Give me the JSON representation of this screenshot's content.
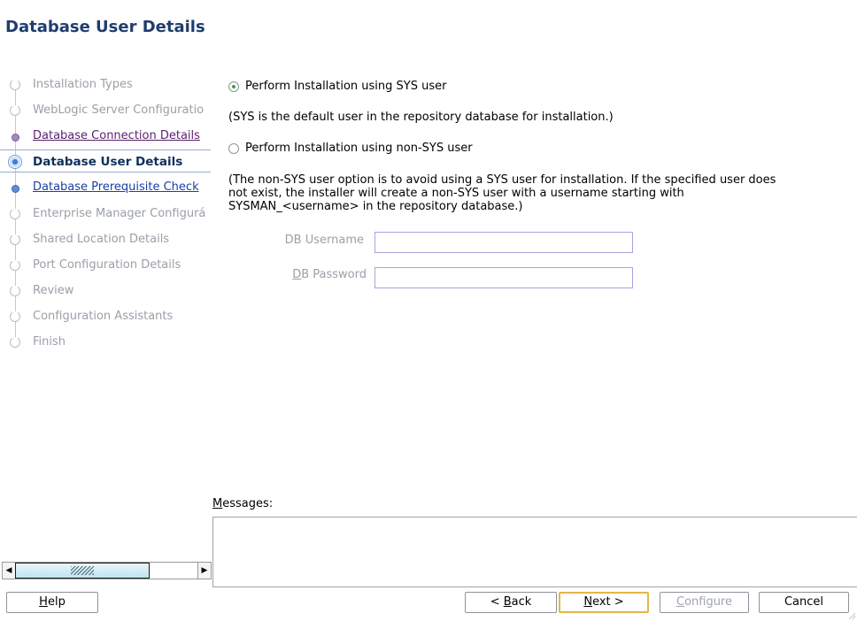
{
  "page": {
    "title": "Database User Details"
  },
  "steps": [
    {
      "label": "Installation Types",
      "state": "future"
    },
    {
      "label": "WebLogic Server Configuratio",
      "state": "future"
    },
    {
      "label": "Database Connection Details",
      "state": "done"
    },
    {
      "label": "Database User Details",
      "state": "current"
    },
    {
      "label": "Database Prerequisite Check",
      "state": "link"
    },
    {
      "label": "Enterprise Manager Configurá",
      "state": "future"
    },
    {
      "label": "Shared Location Details",
      "state": "future"
    },
    {
      "label": "Port Configuration Details",
      "state": "future"
    },
    {
      "label": "Review",
      "state": "future"
    },
    {
      "label": "Configuration Assistants",
      "state": "future"
    },
    {
      "label": "Finish",
      "state": "future"
    }
  ],
  "options": {
    "sys": {
      "label": "Perform Installation using SYS user",
      "selected": true,
      "description": "(SYS is the default user in the repository database for installation.)"
    },
    "nonsys": {
      "label": "Perform Installation using non-SYS user",
      "selected": false,
      "description_lines": [
        "(The non-SYS user option is to avoid using a SYS user for installation. If the specified user does",
        "not exist, the installer will create a non-SYS user with a username starting with",
        "SYSMAN_<username> in the repository database.)"
      ]
    }
  },
  "fields": {
    "username": {
      "label": "DB Username",
      "value": ""
    },
    "password": {
      "label_mnemonic": "D",
      "label_rest": "B Password",
      "value": ""
    }
  },
  "messages": {
    "label_mnemonic": "M",
    "label_rest": "essages:",
    "content": ""
  },
  "buttons": {
    "help": {
      "mnemonic": "H",
      "rest": "elp"
    },
    "back": {
      "prefix": "< ",
      "mnemonic": "B",
      "rest": "ack"
    },
    "next": {
      "mnemonic": "N",
      "rest": "ext >"
    },
    "configure": {
      "mnemonic": "C",
      "rest": "onfigure"
    },
    "cancel": {
      "label": "Cancel"
    }
  },
  "colors": {
    "title": "#1f3d6e",
    "step_done": "#5a1f6e",
    "step_link": "#1a3fa8",
    "default_button_border": "#e4b64a",
    "radio_selected": "#3aa73a"
  }
}
